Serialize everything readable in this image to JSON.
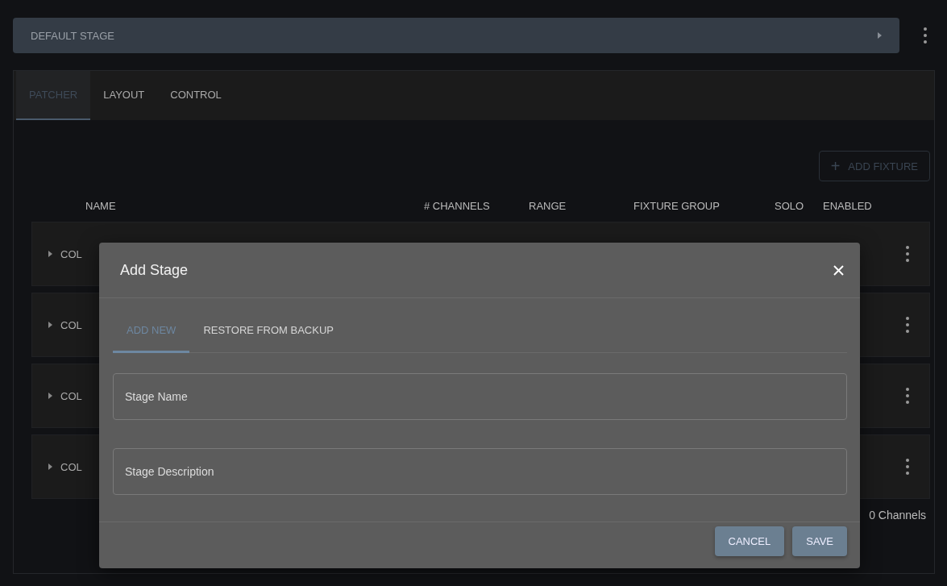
{
  "stage_bar": {
    "title": "DEFAULT STAGE"
  },
  "tabs": [
    {
      "label": "PATCHER",
      "selected": true
    },
    {
      "label": "LAYOUT",
      "selected": false
    },
    {
      "label": "CONTROL",
      "selected": false
    }
  ],
  "add_fixture_button": {
    "icon": "+",
    "label": "ADD FIXTURE"
  },
  "table": {
    "columns": [
      "NAME",
      "# CHANNELS",
      "RANGE",
      "FIXTURE GROUP",
      "SOLO",
      "ENABLED"
    ],
    "rows": [
      {
        "name": "COL",
        "expanded": false
      },
      {
        "name": "COL",
        "expanded": false
      },
      {
        "name": "COL",
        "expanded": false
      },
      {
        "name": "COL",
        "expanded": false
      }
    ],
    "footer": "0 Channels"
  },
  "dialog": {
    "title": "Add Stage",
    "tabs": [
      {
        "label": "ADD NEW",
        "selected": true
      },
      {
        "label": "RESTORE FROM BACKUP",
        "selected": false
      }
    ],
    "fields": [
      {
        "placeholder": "Stage Name"
      },
      {
        "placeholder": "Stage Description"
      }
    ],
    "buttons": [
      "CANCEL",
      "SAVE"
    ]
  }
}
